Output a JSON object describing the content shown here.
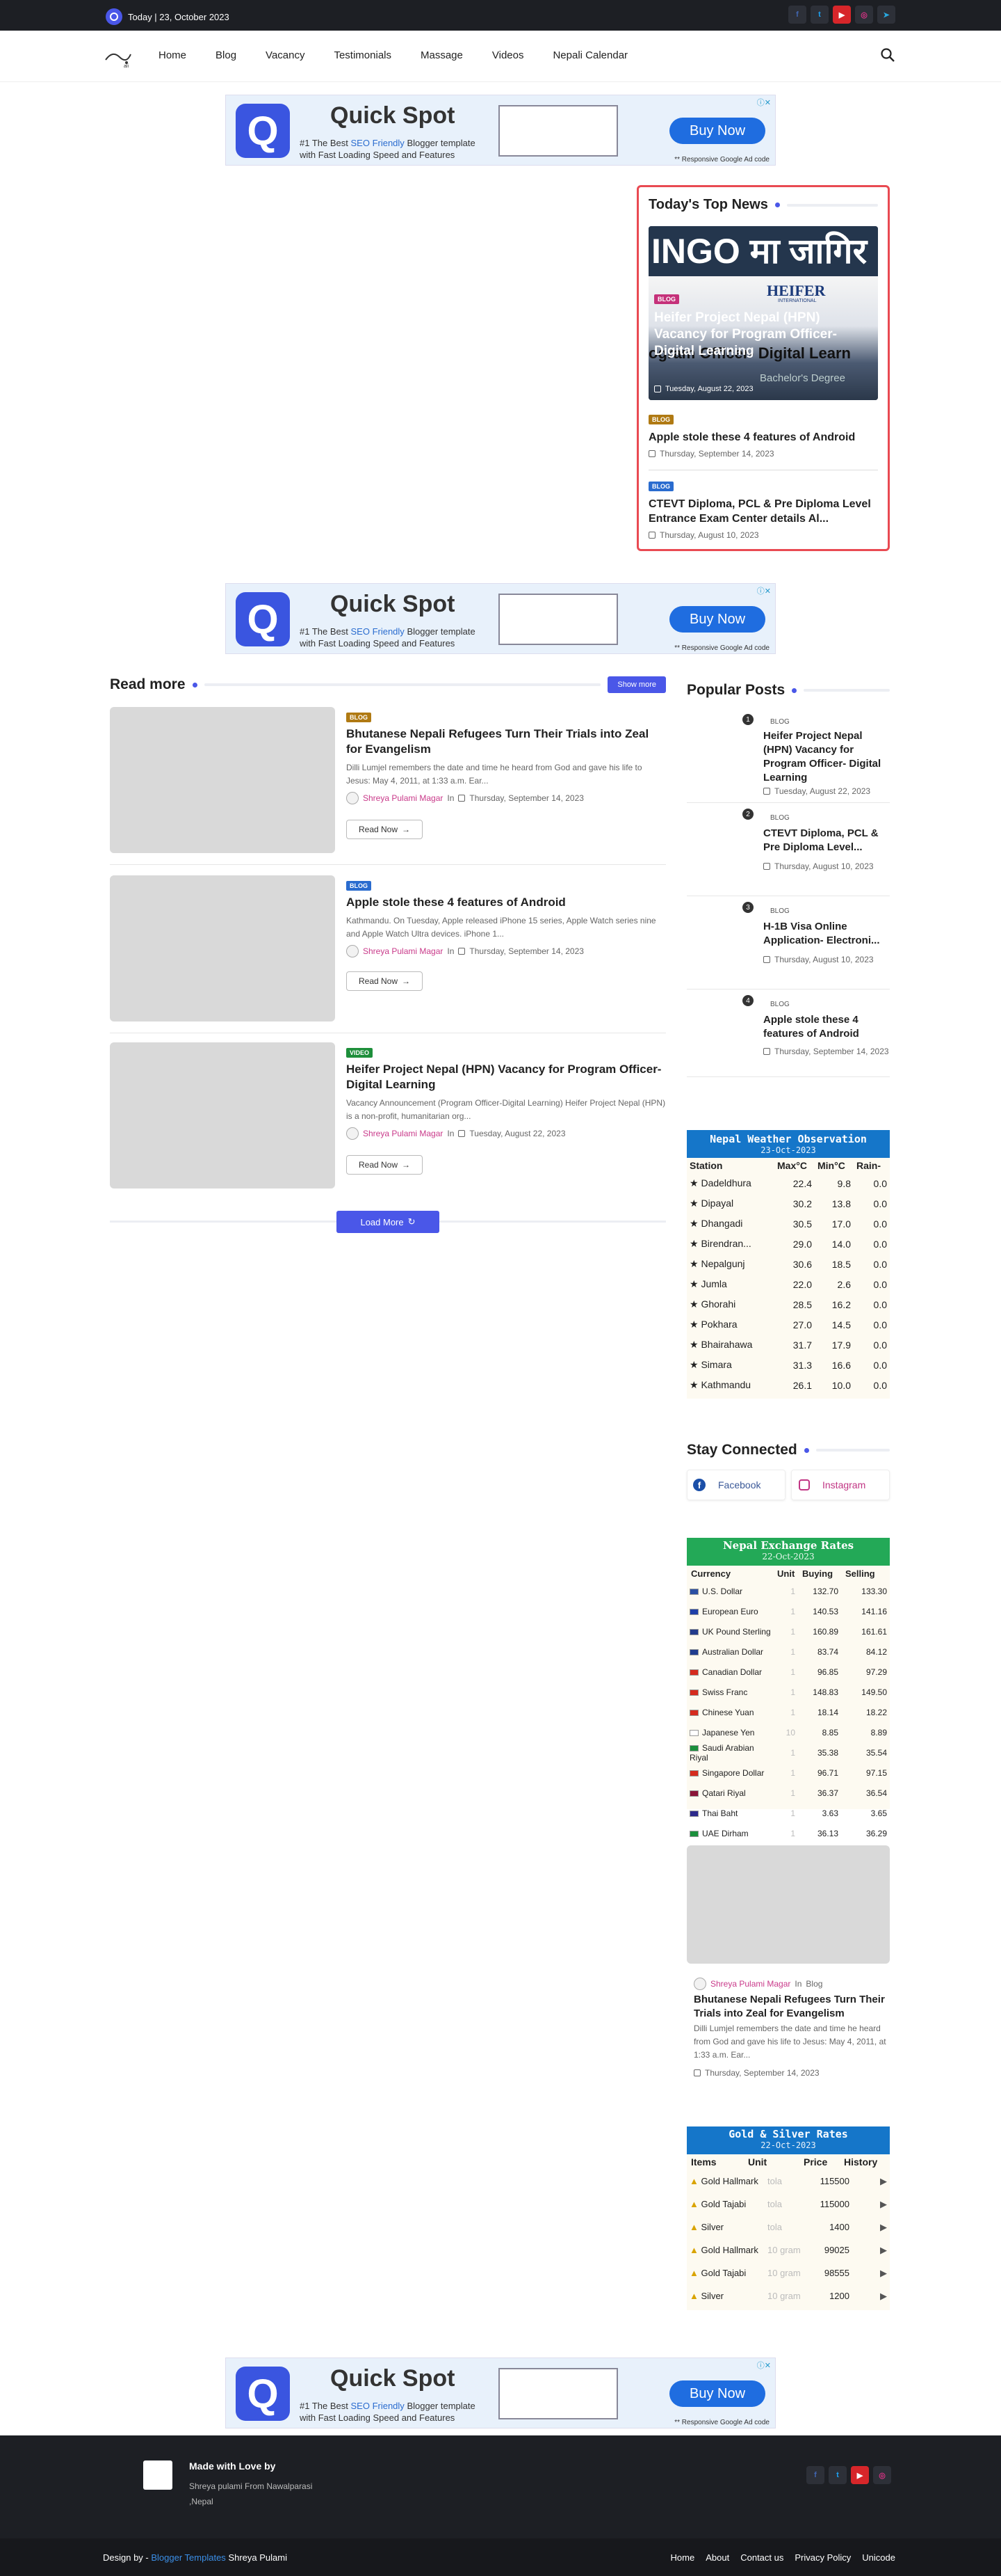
{
  "topbar": {
    "date": "Today | 23, October 2023",
    "social": [
      "f",
      "t",
      "yt",
      "ig",
      "tg"
    ]
  },
  "nav": {
    "items": [
      "Home",
      "Blog",
      "Vacancy",
      "Testimonials",
      "Massage",
      "Videos",
      "Nepali Calendar"
    ]
  },
  "ad": {
    "brand": "Quick Spot",
    "line1": "#1 The Best",
    "line1b": "SEO Friendly",
    "line1c": "Blogger template",
    "line2": "with Fast Loading Speed and Features",
    "cta": "Buy Now",
    "note": "** Responsive Google Ad code"
  },
  "topnews": {
    "title": "Today's Top News",
    "feature": {
      "image_text": "INGO मा जागिर",
      "heifer": "HEIFER",
      "heifer_sub": "INTERNATIONAL",
      "title": "Heifer Project Nepal (HPN) Vacancy for Program Officer- Digital Learning",
      "date": "Tuesday, August 22, 2023",
      "badge": "BLOG",
      "bg1": "ogram Officer- Digital Learn",
      "bg2": "Bachelor's Degree"
    },
    "items": [
      {
        "badge": "BLOG",
        "title": "Apple stole these 4 features of Android",
        "date": "Thursday, September 14, 2023"
      },
      {
        "badge": "BLOG",
        "title": "CTEVT Diploma, PCL & Pre Diploma Level Entrance Exam Center details Al...",
        "date": "Thursday, August 10, 2023"
      }
    ]
  },
  "readmore": {
    "title": "Read more",
    "show_more": "Show more",
    "load_more": "Load More",
    "read_now": "Read Now",
    "posts": [
      {
        "badge": "BLOG",
        "title": "Bhutanese Nepali Refugees Turn Their Trials into Zeal for Evangelism",
        "excerpt": "Dilli Lumjel remembers the date and time he heard from God and gave his life to Jesus: May 4, 2011, at 1:33 a.m. Ear...",
        "author": "Shreya Pulami Magar",
        "in": "In",
        "date": "Thursday, September 14, 2023"
      },
      {
        "badge": "BLOG",
        "title": "Apple stole these 4 features of Android",
        "excerpt": "Kathmandu. On Tuesday, Apple released iPhone 15 series, Apple Watch series nine and Apple Watch Ultra devices. iPhone 1...",
        "author": "Shreya Pulami Magar",
        "in": "In",
        "date": "Thursday, September 14, 2023"
      },
      {
        "badge": "VIDEO",
        "title": "Heifer Project Nepal (HPN) Vacancy for Program Officer-Digital Learning",
        "excerpt": "Vacancy Announcement (Program Officer-Digital Learning)  Heifer Project Nepal (HPN) is a non-profit, humanitarian org...",
        "author": "Shreya Pulami Magar",
        "in": "In",
        "date": "Tuesday, August 22, 2023"
      }
    ]
  },
  "popular": {
    "title": "Popular Posts",
    "items": [
      {
        "n": "1",
        "badge": "BLOG",
        "title": "Heifer Project Nepal (HPN) Vacancy for Program Officer- Digital Learning",
        "date": "Tuesday, August 22, 2023"
      },
      {
        "n": "2",
        "badge": "BLOG",
        "title": "CTEVT Diploma, PCL & Pre Diploma Level...",
        "date": "Thursday, August 10, 2023"
      },
      {
        "n": "3",
        "badge": "BLOG",
        "title": "H-1B Visa Online Application- Electroni...",
        "date": "Thursday, August 10, 2023"
      },
      {
        "n": "4",
        "badge": "BLOG",
        "title": "Apple stole these 4 features of Android",
        "date": "Thursday, September 14, 2023"
      }
    ]
  },
  "weather": {
    "title": "Nepal Weather Observation",
    "date": "23-Oct-2023",
    "headers": [
      "Station",
      "Max°C",
      "Min°C",
      "Rain-"
    ],
    "rows": [
      [
        "Dadeldhura",
        "22.4",
        "9.8",
        "0.0"
      ],
      [
        "Dipayal",
        "30.2",
        "13.8",
        "0.0"
      ],
      [
        "Dhangadi",
        "30.5",
        "17.0",
        "0.0"
      ],
      [
        "Birendran...",
        "29.0",
        "14.0",
        "0.0"
      ],
      [
        "Nepalgunj",
        "30.6",
        "18.5",
        "0.0"
      ],
      [
        "Jumla",
        "22.0",
        "2.6",
        "0.0"
      ],
      [
        "Ghorahi",
        "28.5",
        "16.2",
        "0.0"
      ],
      [
        "Pokhara",
        "27.0",
        "14.5",
        "0.0"
      ],
      [
        "Bhairahawa",
        "31.7",
        "17.9",
        "0.0"
      ],
      [
        "Simara",
        "31.3",
        "16.6",
        "0.0"
      ],
      [
        "Kathmandu",
        "26.1",
        "10.0",
        "0.0"
      ]
    ]
  },
  "stay": {
    "title": "Stay Connected",
    "facebook": "Facebook",
    "instagram": "Instagram"
  },
  "exchange": {
    "title": "Nepal Exchange Rates",
    "date": "22-Oct-2023",
    "headers": [
      "Currency",
      "Unit",
      "Buying",
      "Selling"
    ],
    "rows": [
      [
        "U.S. Dollar",
        "1",
        "132.70",
        "133.30"
      ],
      [
        "European Euro",
        "1",
        "140.53",
        "141.16"
      ],
      [
        "UK Pound Sterling",
        "1",
        "160.89",
        "161.61"
      ],
      [
        "Australian Dollar",
        "1",
        "83.74",
        "84.12"
      ],
      [
        "Canadian Dollar",
        "1",
        "96.85",
        "97.29"
      ],
      [
        "Swiss Franc",
        "1",
        "148.83",
        "149.50"
      ],
      [
        "Chinese Yuan",
        "1",
        "18.14",
        "18.22"
      ],
      [
        "Japanese Yen",
        "10",
        "8.85",
        "8.89"
      ],
      [
        "Saudi Arabian Riyal",
        "1",
        "35.38",
        "35.54"
      ],
      [
        "Singapore Dollar",
        "1",
        "96.71",
        "97.15"
      ],
      [
        "Qatari Riyal",
        "1",
        "36.37",
        "36.54"
      ],
      [
        "Thai Baht",
        "1",
        "3.63",
        "3.65"
      ],
      [
        "UAE Dirham",
        "1",
        "36.13",
        "36.29"
      ]
    ]
  },
  "featured": {
    "author": "Shreya Pulami Magar",
    "in": "In",
    "category": "Blog",
    "title": "Bhutanese Nepali Refugees Turn Their Trials into Zeal for Evangelism",
    "excerpt": "Dilli Lumjel remembers the date and time he heard from God and gave his life to Jesus: May 4, 2011, at 1:33 a.m. Ear...",
    "date": "Thursday, September 14, 2023"
  },
  "gold": {
    "title": "Gold & Silver Rates",
    "date": "22-Oct-2023",
    "headers": [
      "Items",
      "Unit",
      "Price",
      "History"
    ],
    "rows": [
      [
        "Gold Hallmark",
        "tola",
        "115500"
      ],
      [
        "Gold Tajabi",
        "tola",
        "115000"
      ],
      [
        "Silver",
        "tola",
        "1400"
      ],
      [
        "Gold Hallmark",
        "10 gram",
        "99025"
      ],
      [
        "Gold Tajabi",
        "10 gram",
        "98555"
      ],
      [
        "Silver",
        "10 gram",
        "1200"
      ]
    ]
  },
  "footer": {
    "made": "Made with Love by",
    "desc1": "Shreya pulami From Nawalparasi",
    "desc2": ",Nepal",
    "design_by": "Design by -",
    "templates": "Blogger Templates",
    "designer": "Shreya Pulami",
    "links": [
      "Home",
      "About",
      "Contact us",
      "Privacy Policy",
      "Unicode"
    ]
  }
}
